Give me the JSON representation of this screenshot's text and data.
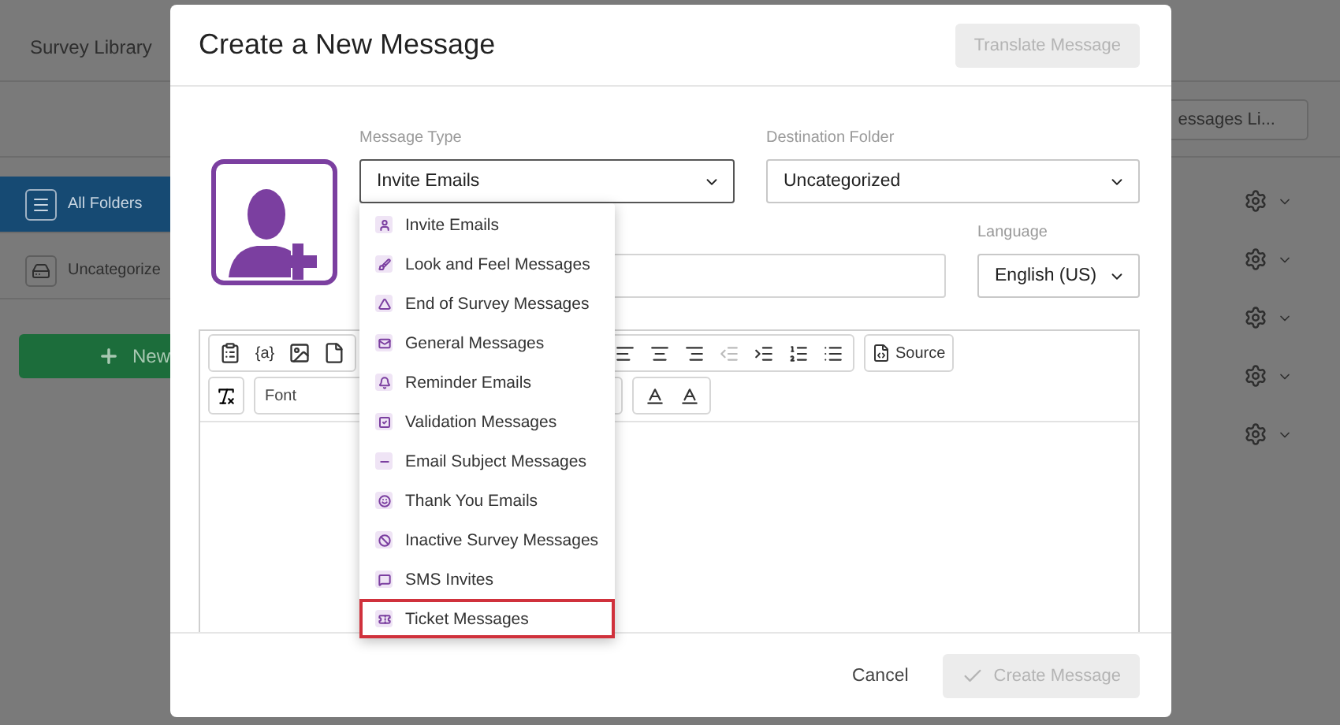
{
  "background": {
    "nav_title": "Survey Library",
    "messages_button": "essages Li...",
    "folders": [
      {
        "label": "All Folders",
        "selected": true
      },
      {
        "label": "Uncategorize",
        "selected": false
      }
    ],
    "new_button": "New"
  },
  "dialog": {
    "title": "Create a New Message",
    "translate_button": {
      "label": "Translate Message",
      "disabled": true
    },
    "message_type": {
      "label": "Message Type",
      "value": "Invite Emails"
    },
    "destination_folder": {
      "label": "Destination Folder",
      "value": "Uncategorized"
    },
    "language": {
      "label": "Language",
      "value": "English (US)"
    },
    "editor": {
      "piped_text": "{a}",
      "source_button": "Source",
      "font_select": "Font"
    },
    "menu": [
      {
        "label": "Invite Emails",
        "selected": false
      },
      {
        "label": "Look and Feel Messages",
        "selected": false
      },
      {
        "label": "End of Survey Messages",
        "selected": false
      },
      {
        "label": "General Messages",
        "selected": false
      },
      {
        "label": "Reminder Emails",
        "selected": false
      },
      {
        "label": "Validation Messages",
        "selected": false
      },
      {
        "label": "Email Subject Messages",
        "selected": false
      },
      {
        "label": "Thank You Emails",
        "selected": false
      },
      {
        "label": "Inactive Survey Messages",
        "selected": false
      },
      {
        "label": "SMS Invites",
        "selected": false
      },
      {
        "label": "Ticket Messages",
        "selected": true
      }
    ],
    "cancel_button": "Cancel",
    "create_button": {
      "label": "Create Message",
      "disabled": true
    }
  }
}
